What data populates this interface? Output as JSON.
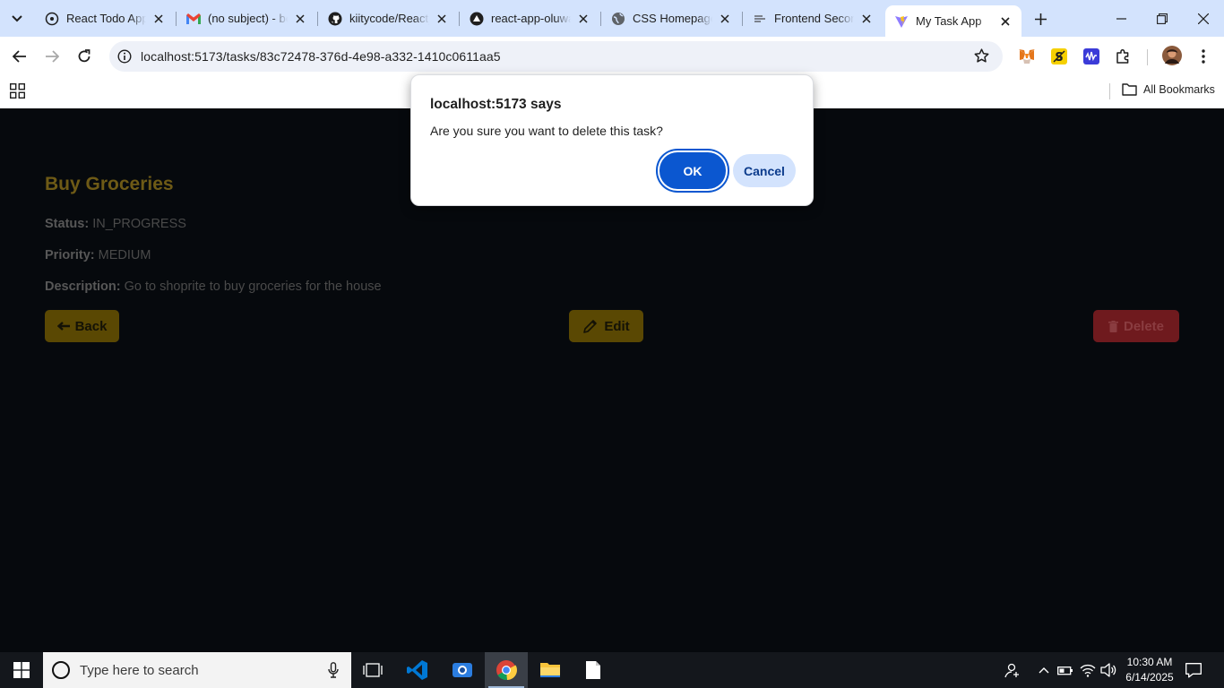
{
  "browser": {
    "tabs": [
      {
        "title": "React Todo App",
        "favicon": "react-icon"
      },
      {
        "title": "(no subject) - be",
        "favicon": "gmail-icon"
      },
      {
        "title": "kiitycode/React_",
        "favicon": "github-icon"
      },
      {
        "title": "react-app-oluwa",
        "favicon": "vercel-icon"
      },
      {
        "title": "CSS Homepage",
        "favicon": "globe-icon"
      },
      {
        "title": "Frontend Second",
        "favicon": "doc-icon"
      },
      {
        "title": "My Task App",
        "favicon": "vite-icon",
        "active": true
      }
    ],
    "url": "localhost:5173/tasks/83c72478-376d-4e98-a332-1410c0611aa5",
    "bookmarks_label": "All Bookmarks"
  },
  "task": {
    "title": "Buy Groceries",
    "status_label": "Status:",
    "status_value": "IN_PROGRESS",
    "priority_label": "Priority:",
    "priority_value": "MEDIUM",
    "description_label": "Description:",
    "description_value": "Go to shoprite to buy groceries for the house",
    "back_label": "Back",
    "edit_label": "Edit",
    "delete_label": "Delete"
  },
  "dialog": {
    "title": "localhost:5173 says",
    "message": "Are you sure you want to delete this task?",
    "ok_label": "OK",
    "cancel_label": "Cancel"
  },
  "taskbar": {
    "search_placeholder": "Type here to search",
    "time": "10:30 AM",
    "date": "6/14/2025"
  },
  "colors": {
    "accent": "#5a4803",
    "danger": "#6f1a1e",
    "dialog_primary": "#0b57d0",
    "page_bg": "#06090d"
  }
}
